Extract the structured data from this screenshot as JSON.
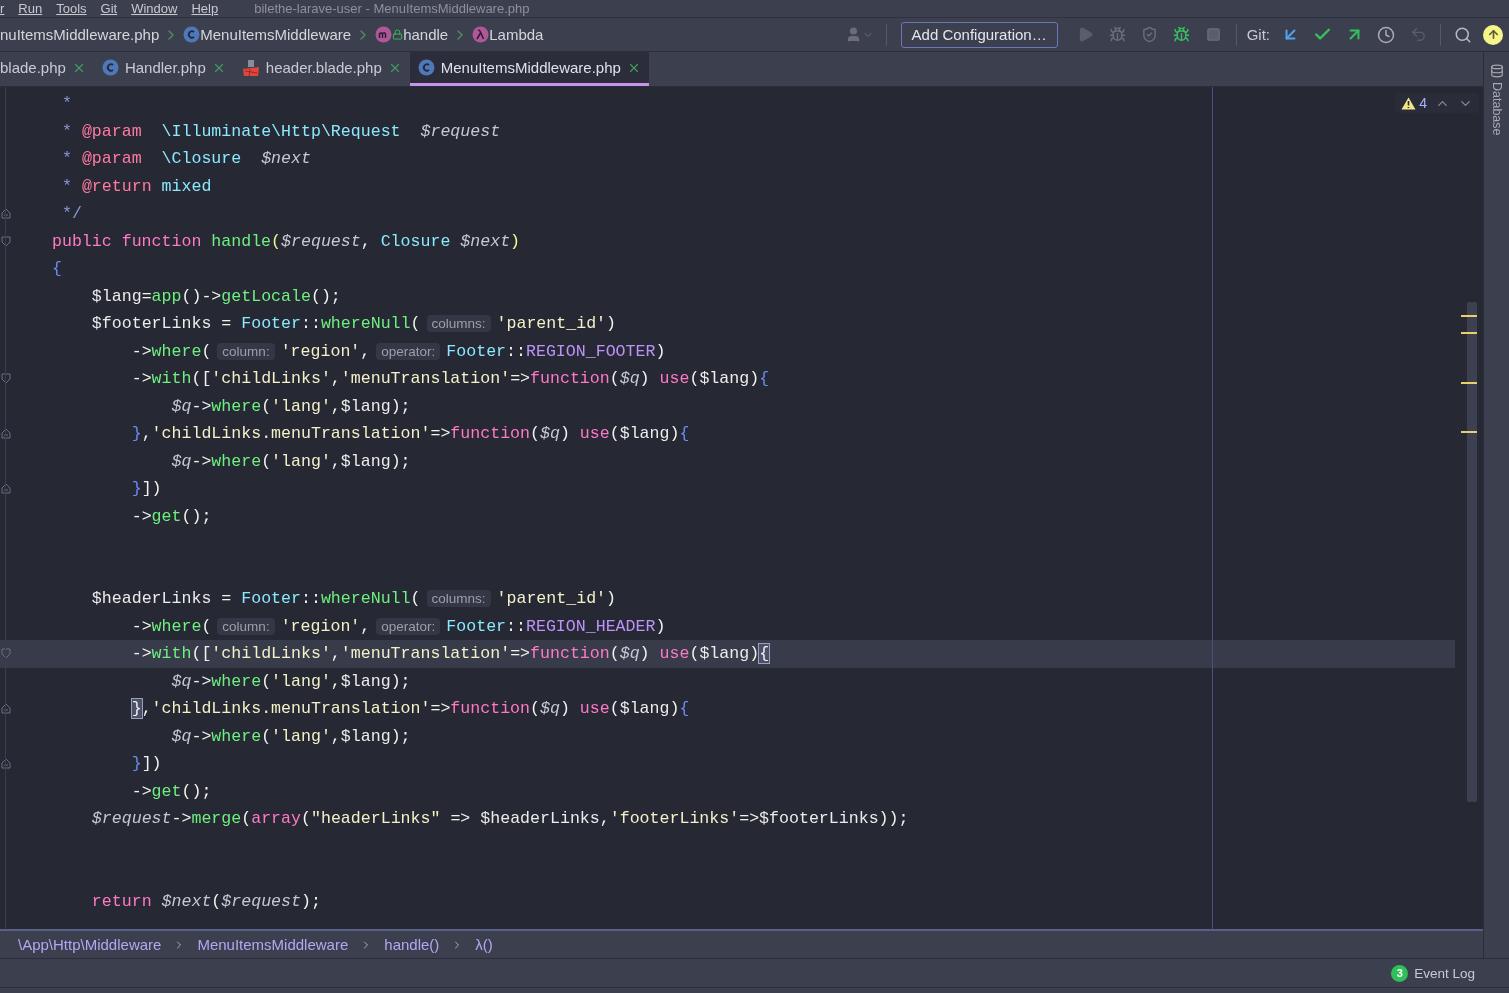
{
  "menu_bar": {
    "items": [
      "r",
      "Run",
      "Tools",
      "Git",
      "Window",
      "Help"
    ],
    "title": "bilethe-larave-user - MenuItemsMiddleware.php"
  },
  "nav_bar": {
    "breadcrumbs": [
      {
        "kind": "file",
        "label": "nuItemsMiddleware.php"
      },
      {
        "kind": "class",
        "label": "MenuItemsMiddleware"
      },
      {
        "kind": "method",
        "label": "handle"
      },
      {
        "kind": "lambda",
        "label": "Lambda"
      }
    ],
    "run_config": "Add Configuration…",
    "git_label": "Git:"
  },
  "tabs": [
    {
      "label": "blade.php",
      "kind": "plain",
      "selected": false
    },
    {
      "label": "Handler.php",
      "kind": "class",
      "selected": false
    },
    {
      "label": "header.blade.php",
      "kind": "blade",
      "selected": false
    },
    {
      "label": "MenuItemsMiddleware.php",
      "kind": "class",
      "selected": true
    }
  ],
  "editor": {
    "warnings": "4",
    "lines": [
      {
        "kind": "code",
        "selected": false,
        "tokens": [
          {
            "kind": "comment",
            "text": " *"
          }
        ]
      },
      {
        "kind": "code",
        "selected": false,
        "tokens": [
          {
            "kind": "comment",
            "text": " * "
          },
          {
            "kind": "doctag",
            "text": "@param"
          },
          {
            "kind": "type",
            "text": "  \\Illuminate\\Http\\Request"
          },
          {
            "kind": "param",
            "text": "  $request"
          }
        ]
      },
      {
        "kind": "code",
        "selected": false,
        "tokens": [
          {
            "kind": "comment",
            "text": " * "
          },
          {
            "kind": "doctag",
            "text": "@param"
          },
          {
            "kind": "type",
            "text": "  \\Closure"
          },
          {
            "kind": "param",
            "text": "  $next"
          }
        ]
      },
      {
        "kind": "code",
        "selected": false,
        "tokens": [
          {
            "kind": "comment",
            "text": " * "
          },
          {
            "kind": "doctag",
            "text": "@return"
          },
          {
            "kind": "type",
            "text": " mixed"
          }
        ]
      },
      {
        "kind": "foldend",
        "selected": false,
        "tokens": [
          {
            "kind": "comment",
            "text": " */"
          }
        ]
      },
      {
        "kind": "foldstart",
        "selected": false,
        "tokens": [
          {
            "kind": "keyword",
            "text": "public function "
          },
          {
            "kind": "function",
            "text": "handle"
          },
          {
            "kind": "paren",
            "text": "("
          },
          {
            "kind": "param",
            "text": "$request"
          },
          {
            "kind": "plain",
            "text": ", "
          },
          {
            "kind": "type",
            "text": "Closure "
          },
          {
            "kind": "param",
            "text": "$next"
          },
          {
            "kind": "paren",
            "text": ")"
          }
        ]
      },
      {
        "kind": "code",
        "selected": false,
        "tokens": [
          {
            "kind": "brace",
            "text": "{"
          }
        ]
      },
      {
        "kind": "code",
        "selected": false,
        "tokens": [
          {
            "kind": "variable",
            "text": "    $lang"
          },
          {
            "kind": "plain",
            "text": "="
          },
          {
            "kind": "function",
            "text": "app"
          },
          {
            "kind": "plain",
            "text": "()->"
          },
          {
            "kind": "function",
            "text": "getLocale"
          },
          {
            "kind": "plain",
            "text": "();"
          }
        ]
      },
      {
        "kind": "code",
        "selected": false,
        "tokens": [
          {
            "kind": "variable",
            "text": "    $footerLinks"
          },
          {
            "kind": "plain",
            "text": " = "
          },
          {
            "kind": "type",
            "text": "Footer"
          },
          {
            "kind": "plain",
            "text": "::"
          },
          {
            "kind": "function",
            "text": "whereNull"
          },
          {
            "kind": "plain",
            "text": "("
          },
          {
            "kind": "hint",
            "text": "columns:"
          },
          {
            "kind": "string",
            "text": "'parent_id'"
          },
          {
            "kind": "plain",
            "text": ")"
          }
        ]
      },
      {
        "kind": "code",
        "selected": false,
        "tokens": [
          {
            "kind": "plain",
            "text": "        ->"
          },
          {
            "kind": "function",
            "text": "where"
          },
          {
            "kind": "plain",
            "text": "("
          },
          {
            "kind": "hint",
            "text": "column:"
          },
          {
            "kind": "string",
            "text": "'region'"
          },
          {
            "kind": "plain",
            "text": ","
          },
          {
            "kind": "hint",
            "text": "operator:"
          },
          {
            "kind": "type",
            "text": "Footer"
          },
          {
            "kind": "plain",
            "text": "::"
          },
          {
            "kind": "constant",
            "text": "REGION_FOOTER"
          },
          {
            "kind": "plain",
            "text": ")"
          }
        ]
      },
      {
        "kind": "foldstart",
        "selected": false,
        "tokens": [
          {
            "kind": "plain",
            "text": "        ->"
          },
          {
            "kind": "function",
            "text": "with"
          },
          {
            "kind": "plain",
            "text": "(["
          },
          {
            "kind": "string",
            "text": "'childLinks'"
          },
          {
            "kind": "plain",
            "text": ","
          },
          {
            "kind": "string",
            "text": "'menuTranslation'"
          },
          {
            "kind": "plain",
            "text": "=>"
          },
          {
            "kind": "keyword",
            "text": "function"
          },
          {
            "kind": "plain",
            "text": "("
          },
          {
            "kind": "param",
            "text": "$q"
          },
          {
            "kind": "plain",
            "text": ") "
          },
          {
            "kind": "keyword",
            "text": "use"
          },
          {
            "kind": "plain",
            "text": "("
          },
          {
            "kind": "variable",
            "text": "$lang"
          },
          {
            "kind": "plain",
            "text": ")"
          },
          {
            "kind": "brace",
            "text": "{"
          }
        ]
      },
      {
        "kind": "code",
        "selected": false,
        "tokens": [
          {
            "kind": "param",
            "text": "            $q"
          },
          {
            "kind": "plain",
            "text": "->"
          },
          {
            "kind": "function",
            "text": "where"
          },
          {
            "kind": "plain",
            "text": "("
          },
          {
            "kind": "string",
            "text": "'lang'"
          },
          {
            "kind": "plain",
            "text": ","
          },
          {
            "kind": "variable",
            "text": "$lang"
          },
          {
            "kind": "plain",
            "text": ");"
          }
        ]
      },
      {
        "kind": "foldend",
        "selected": false,
        "tokens": [
          {
            "kind": "brace",
            "text": "        }"
          },
          {
            "kind": "plain",
            "text": ","
          },
          {
            "kind": "string",
            "text": "'childLinks.menuTranslation'"
          },
          {
            "kind": "plain",
            "text": "=>"
          },
          {
            "kind": "keyword",
            "text": "function"
          },
          {
            "kind": "plain",
            "text": "("
          },
          {
            "kind": "param",
            "text": "$q"
          },
          {
            "kind": "plain",
            "text": ") "
          },
          {
            "kind": "keyword",
            "text": "use"
          },
          {
            "kind": "plain",
            "text": "("
          },
          {
            "kind": "variable",
            "text": "$lang"
          },
          {
            "kind": "plain",
            "text": ")"
          },
          {
            "kind": "brace",
            "text": "{"
          }
        ]
      },
      {
        "kind": "code",
        "selected": false,
        "tokens": [
          {
            "kind": "param",
            "text": "            $q"
          },
          {
            "kind": "plain",
            "text": "->"
          },
          {
            "kind": "function",
            "text": "where"
          },
          {
            "kind": "plain",
            "text": "("
          },
          {
            "kind": "string",
            "text": "'lang'"
          },
          {
            "kind": "plain",
            "text": ","
          },
          {
            "kind": "variable",
            "text": "$lang"
          },
          {
            "kind": "plain",
            "text": ");"
          }
        ]
      },
      {
        "kind": "foldend",
        "selected": false,
        "tokens": [
          {
            "kind": "brace",
            "text": "        }"
          },
          {
            "kind": "plain",
            "text": "])"
          }
        ]
      },
      {
        "kind": "code",
        "selected": false,
        "tokens": [
          {
            "kind": "plain",
            "text": "        ->"
          },
          {
            "kind": "function",
            "text": "get"
          },
          {
            "kind": "plain",
            "text": "();"
          }
        ]
      },
      {
        "kind": "blank",
        "selected": false
      },
      {
        "kind": "blank",
        "selected": false
      },
      {
        "kind": "code",
        "selected": false,
        "tokens": [
          {
            "kind": "variable",
            "text": "    $headerLinks"
          },
          {
            "kind": "plain",
            "text": " = "
          },
          {
            "kind": "type",
            "text": "Footer"
          },
          {
            "kind": "plain",
            "text": "::"
          },
          {
            "kind": "function",
            "text": "whereNull"
          },
          {
            "kind": "plain",
            "text": "("
          },
          {
            "kind": "hint",
            "text": "columns:"
          },
          {
            "kind": "string",
            "text": "'parent_id'"
          },
          {
            "kind": "plain",
            "text": ")"
          }
        ]
      },
      {
        "kind": "code",
        "selected": false,
        "tokens": [
          {
            "kind": "plain",
            "text": "        ->"
          },
          {
            "kind": "function",
            "text": "where"
          },
          {
            "kind": "plain",
            "text": "("
          },
          {
            "kind": "hint",
            "text": "column:"
          },
          {
            "kind": "string",
            "text": "'region'"
          },
          {
            "kind": "plain",
            "text": ","
          },
          {
            "kind": "hint",
            "text": "operator:"
          },
          {
            "kind": "type",
            "text": "Footer"
          },
          {
            "kind": "plain",
            "text": "::"
          },
          {
            "kind": "constant",
            "text": "REGION_HEADER"
          },
          {
            "kind": "plain",
            "text": ")"
          }
        ]
      },
      {
        "kind": "foldstart",
        "selected": true,
        "tokens": [
          {
            "kind": "plain",
            "text": "        ->"
          },
          {
            "kind": "function",
            "text": "with"
          },
          {
            "kind": "plain",
            "text": "(["
          },
          {
            "kind": "string",
            "text": "'childLinks'"
          },
          {
            "kind": "plain",
            "text": ","
          },
          {
            "kind": "string",
            "text": "'menuTranslation'"
          },
          {
            "kind": "plain",
            "text": "=>"
          },
          {
            "kind": "keyword",
            "text": "function"
          },
          {
            "kind": "plain",
            "text": "("
          },
          {
            "kind": "param",
            "text": "$q"
          },
          {
            "kind": "plain",
            "text": ") "
          },
          {
            "kind": "keyword",
            "text": "use"
          },
          {
            "kind": "plain",
            "text": "("
          },
          {
            "kind": "variable",
            "text": "$lang"
          },
          {
            "kind": "plain",
            "text": ")"
          },
          {
            "kind": "matched",
            "text": "{"
          }
        ]
      },
      {
        "kind": "code",
        "selected": false,
        "tokens": [
          {
            "kind": "param",
            "text": "            $q"
          },
          {
            "kind": "plain",
            "text": "->"
          },
          {
            "kind": "function",
            "text": "where"
          },
          {
            "kind": "plain",
            "text": "("
          },
          {
            "kind": "string",
            "text": "'lang'"
          },
          {
            "kind": "plain",
            "text": ","
          },
          {
            "kind": "variable",
            "text": "$lang"
          },
          {
            "kind": "plain",
            "text": ");"
          }
        ]
      },
      {
        "kind": "foldend",
        "selected": false,
        "tokens": [
          {
            "kind": "matched",
            "text": "        }"
          },
          {
            "kind": "plain",
            "text": ","
          },
          {
            "kind": "string",
            "text": "'childLinks.menuTranslation'"
          },
          {
            "kind": "plain",
            "text": "=>"
          },
          {
            "kind": "keyword",
            "text": "function"
          },
          {
            "kind": "plain",
            "text": "("
          },
          {
            "kind": "param",
            "text": "$q"
          },
          {
            "kind": "plain",
            "text": ") "
          },
          {
            "kind": "keyword",
            "text": "use"
          },
          {
            "kind": "plain",
            "text": "("
          },
          {
            "kind": "variable",
            "text": "$lang"
          },
          {
            "kind": "plain",
            "text": ")"
          },
          {
            "kind": "brace",
            "text": "{"
          }
        ]
      },
      {
        "kind": "code",
        "selected": false,
        "tokens": [
          {
            "kind": "param",
            "text": "            $q"
          },
          {
            "kind": "plain",
            "text": "->"
          },
          {
            "kind": "function",
            "text": "where"
          },
          {
            "kind": "plain",
            "text": "("
          },
          {
            "kind": "string",
            "text": "'lang'"
          },
          {
            "kind": "plain",
            "text": ","
          },
          {
            "kind": "variable",
            "text": "$lang"
          },
          {
            "kind": "plain",
            "text": ");"
          }
        ]
      },
      {
        "kind": "foldend",
        "selected": false,
        "tokens": [
          {
            "kind": "brace",
            "text": "        }"
          },
          {
            "kind": "plain",
            "text": "])"
          }
        ]
      },
      {
        "kind": "code",
        "selected": false,
        "tokens": [
          {
            "kind": "plain",
            "text": "        ->"
          },
          {
            "kind": "function",
            "text": "get"
          },
          {
            "kind": "plain",
            "text": "();"
          }
        ]
      },
      {
        "kind": "code",
        "selected": false,
        "tokens": [
          {
            "kind": "param",
            "text": "    $request"
          },
          {
            "kind": "plain",
            "text": "->"
          },
          {
            "kind": "function",
            "text": "merge"
          },
          {
            "kind": "plain",
            "text": "("
          },
          {
            "kind": "keyword",
            "text": "array"
          },
          {
            "kind": "plain",
            "text": "("
          },
          {
            "kind": "string",
            "text": "\"headerLinks\""
          },
          {
            "kind": "plain",
            "text": " => "
          },
          {
            "kind": "variable",
            "text": "$headerLinks"
          },
          {
            "kind": "plain",
            "text": ","
          },
          {
            "kind": "string",
            "text": "'footerLinks'"
          },
          {
            "kind": "plain",
            "text": "=>"
          },
          {
            "kind": "variable",
            "text": "$footerLinks"
          },
          {
            "kind": "plain",
            "text": "));"
          }
        ]
      },
      {
        "kind": "blank",
        "selected": false
      },
      {
        "kind": "blank",
        "selected": false
      },
      {
        "kind": "code",
        "selected": false,
        "tokens": [
          {
            "kind": "keyword",
            "text": "    return "
          },
          {
            "kind": "param",
            "text": "$next"
          },
          {
            "kind": "plain",
            "text": "("
          },
          {
            "kind": "param",
            "text": "$request"
          },
          {
            "kind": "plain",
            "text": ");"
          }
        ]
      }
    ]
  },
  "structure_path": [
    "\\App\\Http\\Middleware",
    "MenuItemsMiddleware",
    "handle()",
    "λ()"
  ],
  "side_panel": {
    "label": "Database"
  },
  "status_bar": {
    "event_count": "3",
    "event_log": "Event Log"
  }
}
